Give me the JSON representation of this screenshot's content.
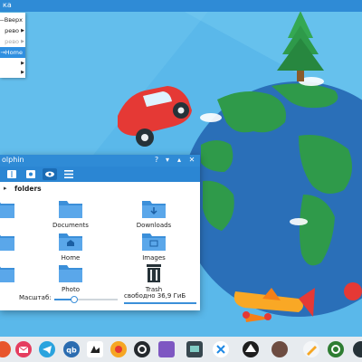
{
  "top_bar": {
    "title": "ка"
  },
  "context_menu": {
    "items": [
      {
        "label": "—Вверх",
        "state": "normal",
        "submenu": false
      },
      {
        "label": "рево",
        "state": "normal",
        "submenu": true
      },
      {
        "label": "рево",
        "state": "disabled",
        "submenu": true
      },
      {
        "label": "→Home",
        "state": "highlighted",
        "submenu": false
      },
      {
        "label": "",
        "state": "normal",
        "submenu": true
      },
      {
        "label": "",
        "state": "normal",
        "submenu": true
      }
    ]
  },
  "file_window": {
    "title": "olphin",
    "controls": [
      "?",
      "▾",
      "▴",
      "✕"
    ],
    "breadcrumb": "folders",
    "items": [
      {
        "label": "",
        "icon": "folder-icon"
      },
      {
        "label": "Documents",
        "icon": "folder-documents-icon"
      },
      {
        "label": "Downloads",
        "icon": "folder-downloads-icon"
      },
      {
        "label": "",
        "icon": "folder-icon"
      },
      {
        "label": "Home",
        "icon": "folder-home-icon"
      },
      {
        "label": "Images",
        "icon": "folder-images-icon"
      },
      {
        "label": "",
        "icon": "folder-icon"
      },
      {
        "label": "Photo",
        "icon": "folder-icon"
      },
      {
        "label": "Trash",
        "icon": "trash-icon"
      }
    ],
    "status": {
      "zoom_label": "Масштаб:",
      "zoom_level": 0.32,
      "free_space": "свободно 36,9 ГиБ"
    }
  },
  "colors": {
    "accent": "#2f8bd6",
    "wallpaper": "#5ab8ea",
    "folder": "#3b8fd9"
  },
  "taskbar": {
    "icons": [
      "firefox-icon",
      "mail-icon",
      "telegram-icon",
      "qbittorrent-icon",
      "photo-viewer-icon",
      "record-icon",
      "github-icon",
      "image-editor-icon",
      "system-monitor-icon",
      "kdeconnect-icon",
      "inkscape-icon",
      "gimp-icon",
      "pen-icon",
      "settings-icon",
      "dark-icon"
    ]
  }
}
